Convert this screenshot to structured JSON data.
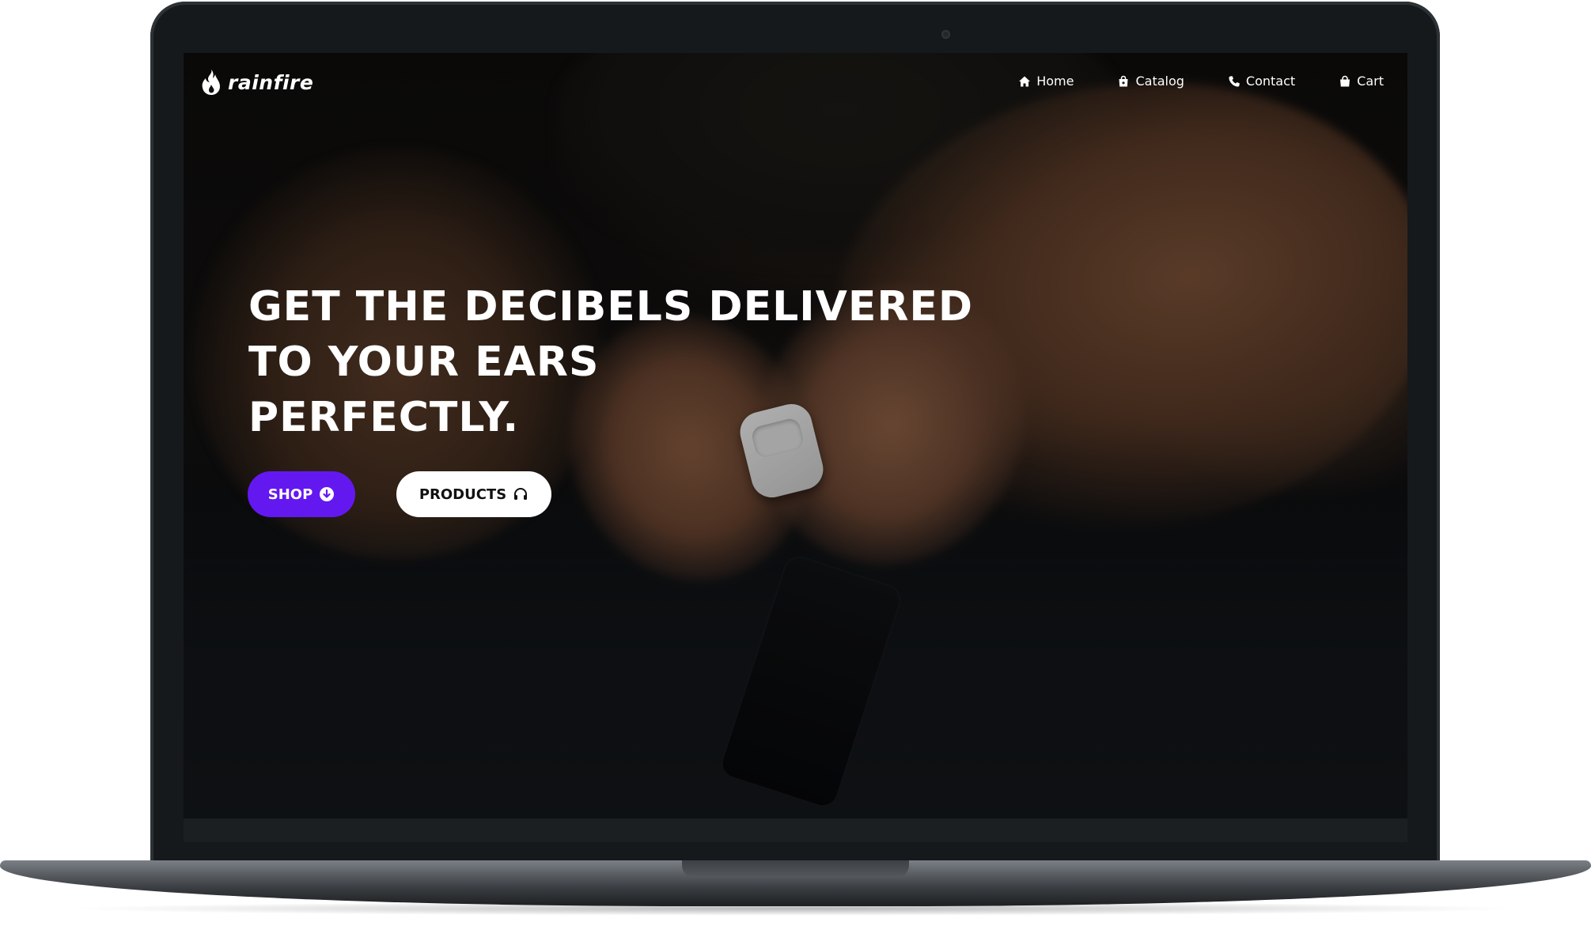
{
  "brand": {
    "name": "rainfire",
    "logo_icon": "flame-icon"
  },
  "nav": {
    "items": [
      {
        "label": "Home",
        "icon": "home-icon"
      },
      {
        "label": "Catalog",
        "icon": "shopping-bag-icon"
      },
      {
        "label": "Contact",
        "icon": "phone-icon"
      },
      {
        "label": "Cart",
        "icon": "bag-icon"
      }
    ]
  },
  "hero": {
    "title_lines": [
      "GET THE DECIBELS DELIVERED",
      "TO YOUR EARS",
      "PERFECTLY."
    ],
    "shop_button": {
      "label": "SHOP",
      "icon": "arrow-down-circle-icon"
    },
    "products_button": {
      "label": "PRODUCTS",
      "icon": "headphones-icon"
    }
  },
  "colors": {
    "accent": "#6418f0",
    "text_on_dark": "#ffffff",
    "button_light": "#ffffff"
  }
}
